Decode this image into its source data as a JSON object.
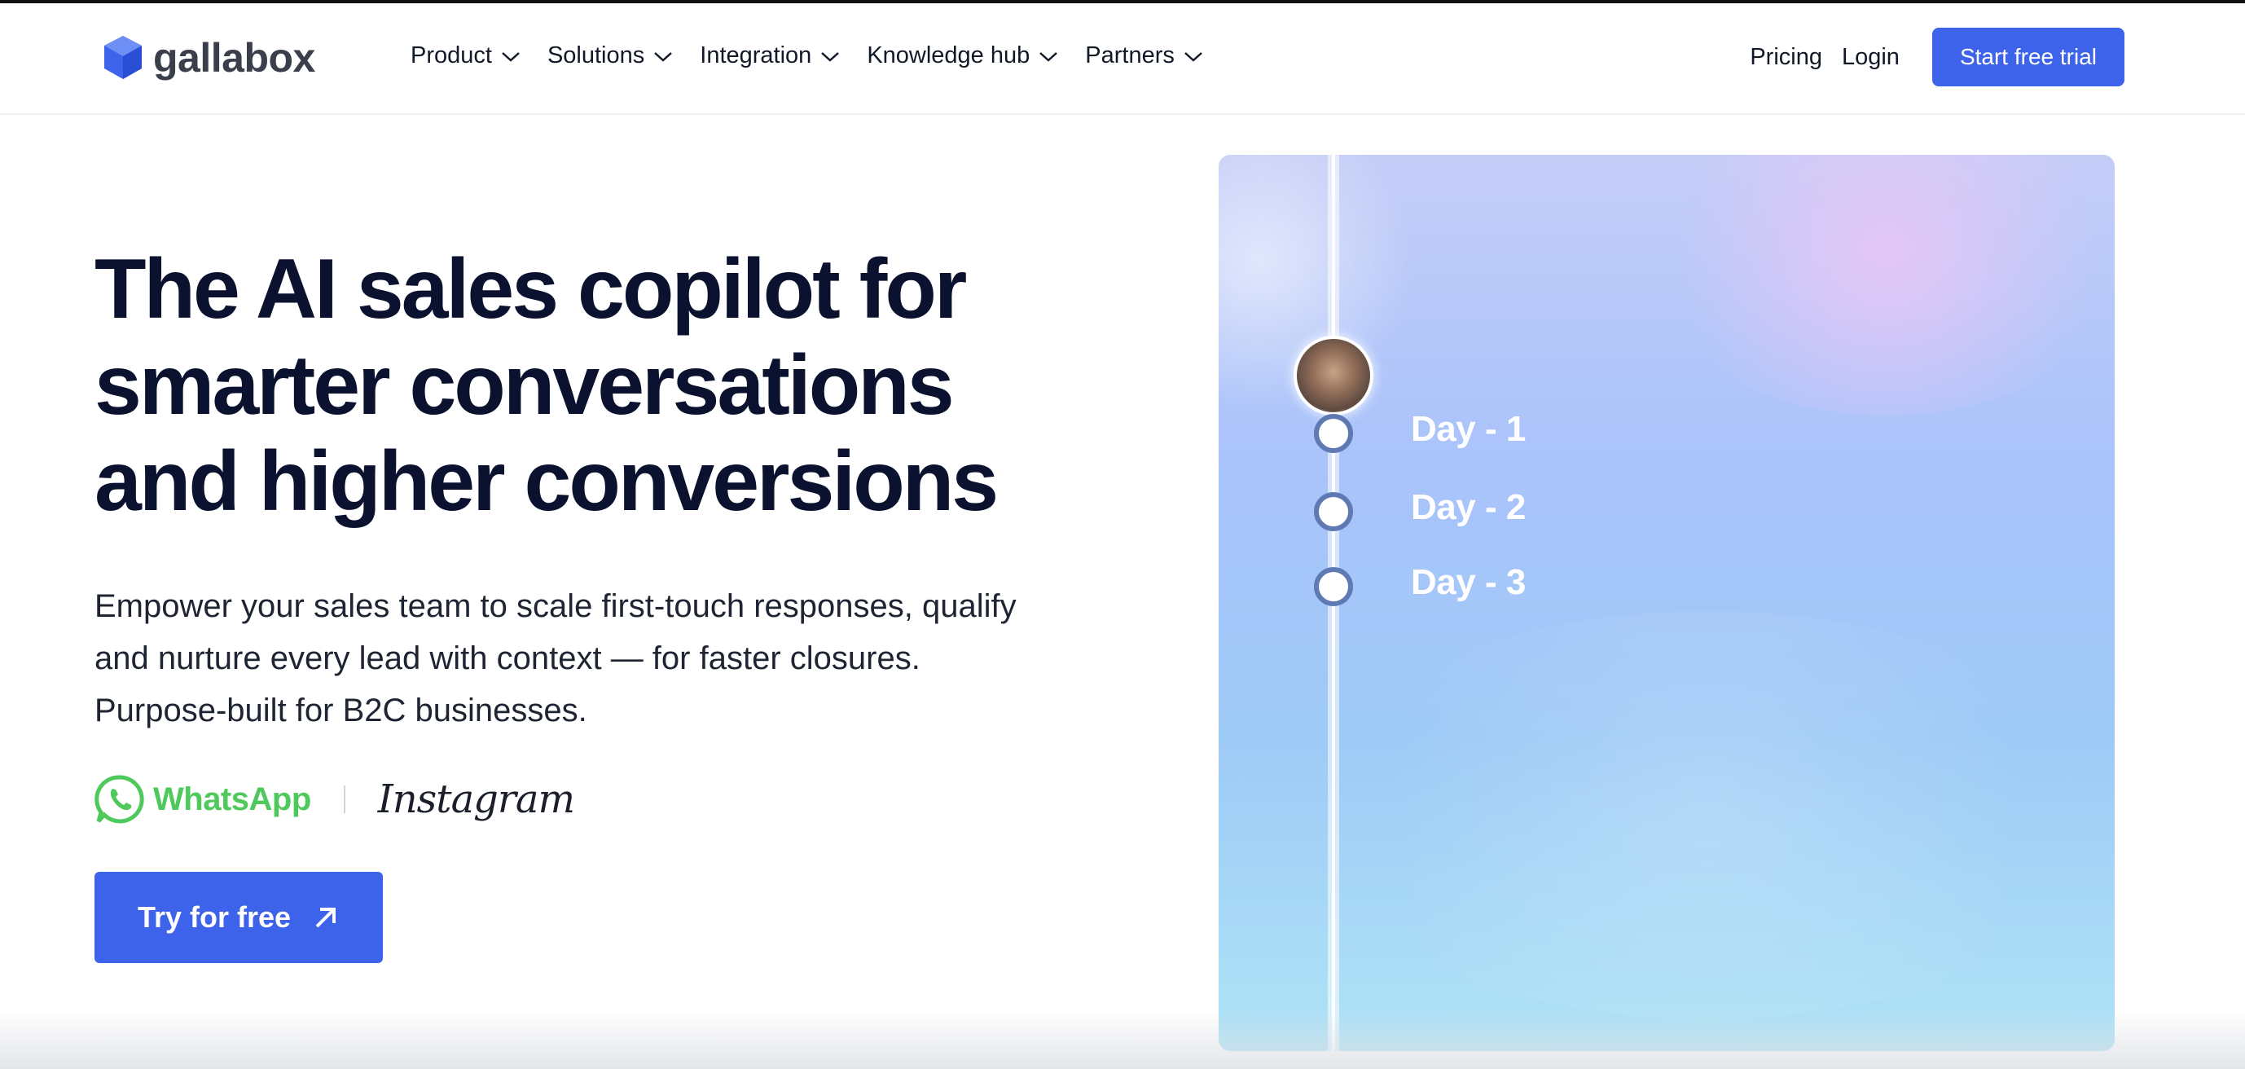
{
  "header": {
    "logo_text": "gallabox",
    "nav": [
      {
        "label": "Product"
      },
      {
        "label": "Solutions"
      },
      {
        "label": "Integration"
      },
      {
        "label": "Knowledge hub"
      },
      {
        "label": "Partners"
      }
    ],
    "pricing": "Pricing",
    "login": "Login",
    "cta": "Start free trial"
  },
  "hero": {
    "title_lines": [
      "The AI sales copilot for",
      "smarter conversations",
      "and higher conversions"
    ],
    "subtitle": "Empower your sales team to scale first-touch responses, qualify and nurture every lead with context — for faster closures. Purpose-built for B2C businesses.",
    "channels": {
      "whatsapp": "WhatsApp",
      "instagram": "Instagram"
    },
    "cta": "Try for free"
  },
  "panel": {
    "days": [
      "Day - 1",
      "Day - 2",
      "Day - 3"
    ]
  },
  "colors": {
    "accent": "#3d63ea",
    "title": "#0b1230",
    "whatsapp": "#4fc95b"
  }
}
